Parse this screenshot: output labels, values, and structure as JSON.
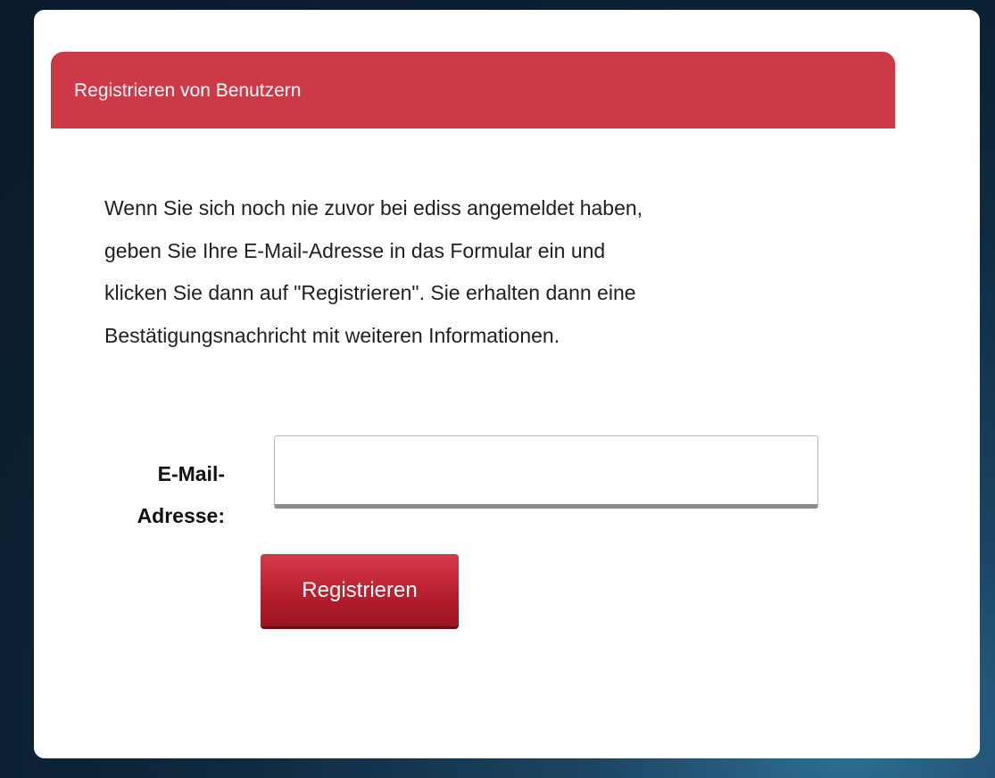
{
  "panel": {
    "title": "Registrieren von Benutzern"
  },
  "intro": {
    "lines": [
      "Wenn Sie sich noch nie zuvor bei ediss angemeldet haben,",
      "geben Sie Ihre E-Mail-Adresse in das Formular ein und",
      "klicken Sie dann auf \"Registrieren\". Sie erhalten dann eine",
      "Bestätigungsnachricht mit weiteren Informationen."
    ]
  },
  "form": {
    "email_label_lines": [
      "E-Mail-",
      "Adresse:"
    ],
    "email_value": "",
    "email_placeholder": "",
    "submit_label": "Registrieren"
  },
  "colors": {
    "accent": "#cc3a48",
    "button": "#b8202f",
    "background": "#0f2a40"
  }
}
